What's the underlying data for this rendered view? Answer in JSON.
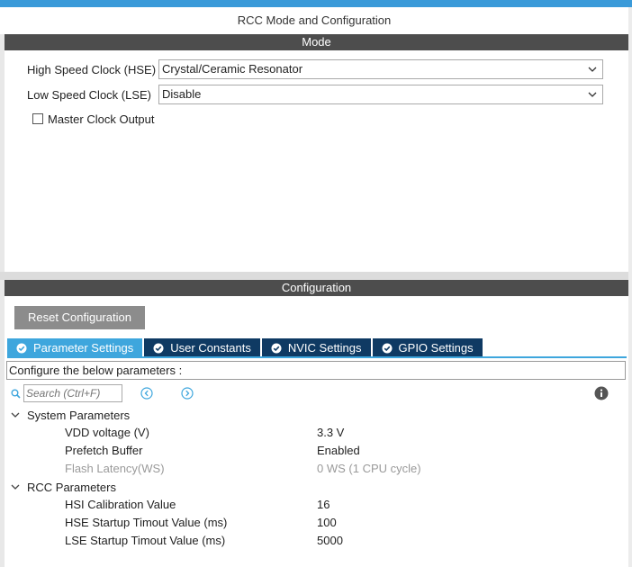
{
  "window": {
    "title": "RCC Mode and Configuration"
  },
  "mode": {
    "header": "Mode",
    "hse": {
      "label": "High Speed Clock (HSE)",
      "value": "Crystal/Ceramic Resonator"
    },
    "lse": {
      "label": "Low Speed Clock (LSE)",
      "value": "Disable"
    },
    "mco": {
      "label": "Master Clock Output",
      "checked": false
    }
  },
  "configuration": {
    "header": "Configuration",
    "reset_label": "Reset Configuration",
    "tabs": [
      {
        "label": "Parameter Settings",
        "active": true,
        "icon": "check-circle-icon"
      },
      {
        "label": "User Constants",
        "active": false,
        "icon": "check-circle-icon"
      },
      {
        "label": "NVIC Settings",
        "active": false,
        "icon": "check-circle-icon"
      },
      {
        "label": "GPIO Settings",
        "active": false,
        "icon": "check-circle-icon"
      }
    ],
    "instructions": "Configure the below parameters :",
    "search": {
      "placeholder": "Search (Ctrl+F)",
      "value": ""
    },
    "groups": [
      {
        "name": "System Parameters",
        "params": [
          {
            "name": "VDD voltage (V)",
            "value": "3.3 V",
            "disabled": false
          },
          {
            "name": "Prefetch Buffer",
            "value": "Enabled",
            "disabled": false
          },
          {
            "name": "Flash Latency(WS)",
            "value": "0 WS (1 CPU cycle)",
            "disabled": true
          }
        ]
      },
      {
        "name": "RCC Parameters",
        "params": [
          {
            "name": "HSI Calibration Value",
            "value": "16",
            "disabled": false
          },
          {
            "name": "HSE Startup Timout Value (ms)",
            "value": "100",
            "disabled": false
          },
          {
            "name": "LSE Startup Timout Value (ms)",
            "value": "5000",
            "disabled": false
          }
        ]
      }
    ]
  },
  "colors": {
    "accent": "#3ea6dd",
    "tab_inactive": "#0f3a63",
    "section_bar": "#4d4d4d",
    "button_gray": "#8c8c8c"
  }
}
